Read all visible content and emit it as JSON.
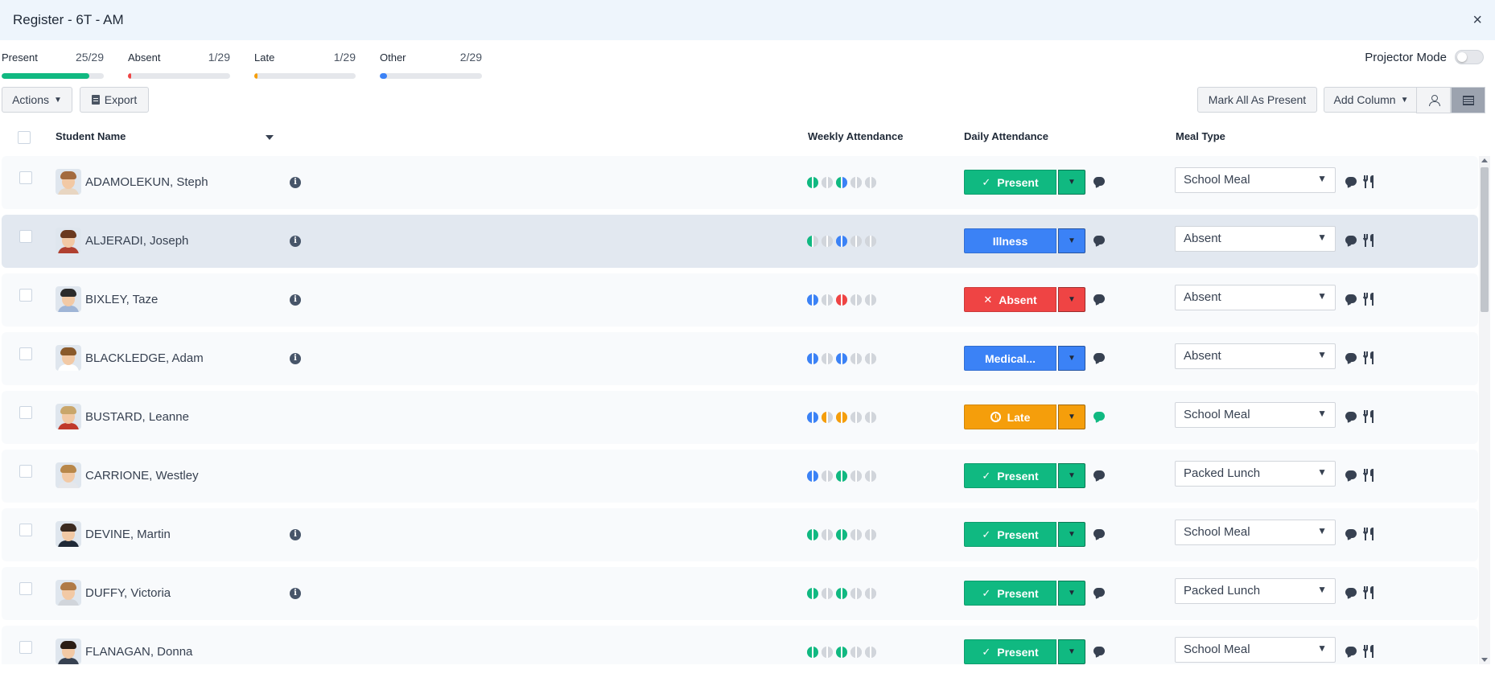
{
  "window": {
    "title": "Register - 6T - AM",
    "close_icon": "×"
  },
  "stats": [
    {
      "label": "Present",
      "count": "25/29",
      "fraction": 0.862,
      "color": "#10b981"
    },
    {
      "label": "Absent",
      "count": "1/29",
      "fraction": 0.034,
      "color": "#ef4444"
    },
    {
      "label": "Late",
      "count": "1/29",
      "fraction": 0.034,
      "color": "#f59e0b"
    },
    {
      "label": "Other",
      "count": "2/29",
      "fraction": 0.069,
      "color": "#3b82f6"
    }
  ],
  "projector": {
    "label": "Projector Mode",
    "enabled": false
  },
  "toolbar": {
    "actions_label": "Actions",
    "export_label": "Export",
    "mark_all_label": "Mark All As Present",
    "add_column_label": "Add Column"
  },
  "columns": {
    "student_name": "Student Name",
    "weekly": "Weekly Attendance",
    "daily": "Daily Attendance",
    "meal": "Meal Type"
  },
  "status_colors": {
    "present": "#10b981",
    "absent": "#ef4444",
    "other": "#3b82f6",
    "late": "#f59e0b",
    "empty": "#d1d5db"
  },
  "students": [
    {
      "name": "ADAMOLEKUN, Steph",
      "info": true,
      "status": "Present",
      "kind": "present",
      "icon": "check-icon",
      "meal": "School Meal",
      "comment_active": false,
      "highlighted": false,
      "weekly": [
        [
          "present",
          "present"
        ],
        [
          "empty",
          "empty"
        ],
        [
          "present",
          "other"
        ],
        [
          "empty",
          "empty"
        ],
        [
          "empty",
          "empty"
        ]
      ]
    },
    {
      "name": "ALJERADI, Joseph",
      "info": true,
      "status": "Illness",
      "kind": "other",
      "icon": "",
      "meal": "Absent",
      "comment_active": false,
      "highlighted": true,
      "weekly": [
        [
          "present",
          "empty"
        ],
        [
          "empty",
          "empty"
        ],
        [
          "other",
          "other"
        ],
        [
          "empty",
          "empty"
        ],
        [
          "empty",
          "empty"
        ]
      ]
    },
    {
      "name": "BIXLEY, Taze",
      "info": true,
      "status": "Absent",
      "kind": "absent",
      "icon": "x-icon",
      "meal": "Absent",
      "comment_active": false,
      "highlighted": false,
      "weekly": [
        [
          "other",
          "other"
        ],
        [
          "empty",
          "empty"
        ],
        [
          "absent",
          "absent"
        ],
        [
          "empty",
          "empty"
        ],
        [
          "empty",
          "empty"
        ]
      ]
    },
    {
      "name": "BLACKLEDGE, Adam",
      "info": true,
      "status": "Medical...",
      "kind": "other",
      "icon": "",
      "meal": "Absent",
      "comment_active": false,
      "highlighted": false,
      "weekly": [
        [
          "other",
          "other"
        ],
        [
          "empty",
          "empty"
        ],
        [
          "other",
          "other"
        ],
        [
          "empty",
          "empty"
        ],
        [
          "empty",
          "empty"
        ]
      ]
    },
    {
      "name": "BUSTARD, Leanne",
      "info": false,
      "status": "Late",
      "kind": "late",
      "icon": "clock-icon",
      "meal": "School Meal",
      "comment_active": true,
      "highlighted": false,
      "weekly": [
        [
          "other",
          "other"
        ],
        [
          "late",
          "empty"
        ],
        [
          "late",
          "late"
        ],
        [
          "empty",
          "empty"
        ],
        [
          "empty",
          "empty"
        ]
      ]
    },
    {
      "name": "CARRIONE, Westley",
      "info": false,
      "status": "Present",
      "kind": "present",
      "icon": "check-icon",
      "meal": "Packed Lunch",
      "comment_active": false,
      "highlighted": false,
      "weekly": [
        [
          "other",
          "other"
        ],
        [
          "empty",
          "empty"
        ],
        [
          "present",
          "present"
        ],
        [
          "empty",
          "empty"
        ],
        [
          "empty",
          "empty"
        ]
      ]
    },
    {
      "name": "DEVINE, Martin",
      "info": true,
      "status": "Present",
      "kind": "present",
      "icon": "check-icon",
      "meal": "School Meal",
      "comment_active": false,
      "highlighted": false,
      "weekly": [
        [
          "present",
          "present"
        ],
        [
          "empty",
          "empty"
        ],
        [
          "present",
          "present"
        ],
        [
          "empty",
          "empty"
        ],
        [
          "empty",
          "empty"
        ]
      ]
    },
    {
      "name": "DUFFY, Victoria",
      "info": true,
      "status": "Present",
      "kind": "present",
      "icon": "check-icon",
      "meal": "Packed Lunch",
      "comment_active": false,
      "highlighted": false,
      "weekly": [
        [
          "present",
          "present"
        ],
        [
          "empty",
          "empty"
        ],
        [
          "present",
          "present"
        ],
        [
          "empty",
          "empty"
        ],
        [
          "empty",
          "empty"
        ]
      ]
    },
    {
      "name": "FLANAGAN, Donna",
      "info": false,
      "status": "Present",
      "kind": "present",
      "icon": "check-icon",
      "meal": "School Meal",
      "comment_active": false,
      "highlighted": false,
      "weekly": [
        [
          "present",
          "present"
        ],
        [
          "empty",
          "empty"
        ],
        [
          "present",
          "present"
        ],
        [
          "empty",
          "empty"
        ],
        [
          "empty",
          "empty"
        ]
      ]
    }
  ]
}
